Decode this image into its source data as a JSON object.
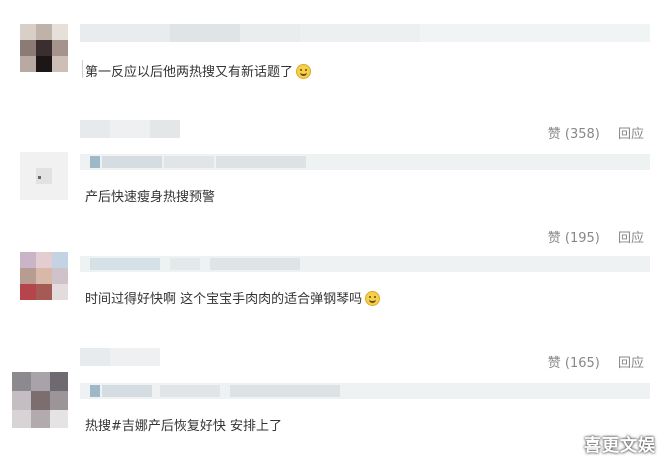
{
  "comments": [
    {
      "text": "第一反应以后他两热搜又有新话题了",
      "emoji": "smile-emoji",
      "likes_label": "赞 (358)",
      "reply_label": "回应"
    },
    {
      "text": "产后快速瘦身热搜预警",
      "likes_label": "赞 (195)",
      "reply_label": "回应"
    },
    {
      "text": "时间过得好快啊 这个宝宝手肉肉的适合弹钢琴吗",
      "emoji": "laugh-emoji",
      "likes_label": "赞 (165)",
      "reply_label": "回应"
    },
    {
      "text": "热搜#吉娜产后恢复好快 安排上了"
    }
  ],
  "watermark": "喜更文娱",
  "colors": {
    "text": "#333333",
    "meta": "#888888",
    "reply_bg": "#eef2f3",
    "emoji": "#f5d04a"
  }
}
